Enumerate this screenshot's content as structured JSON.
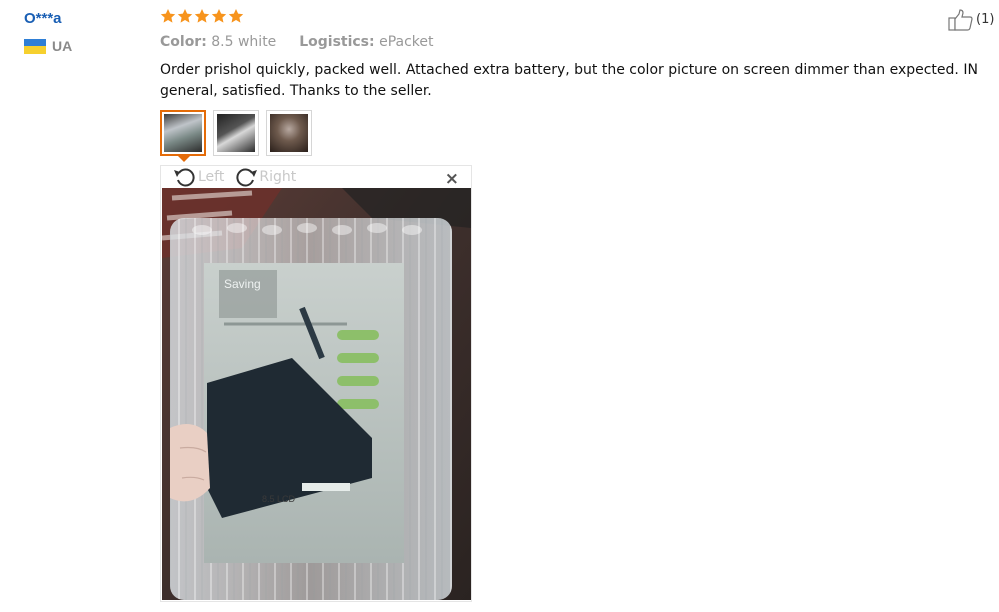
{
  "reviewer": {
    "name": "O***a",
    "country": "UA"
  },
  "rating": {
    "stars": 5,
    "max": 5,
    "color": "#f7941d"
  },
  "helpful": {
    "count": "(1)"
  },
  "meta": {
    "color_label": "Color:",
    "color_value": "8.5 white",
    "logistics_label": "Logistics:",
    "logistics_value": "ePacket"
  },
  "review_text": "Order prishol quickly, packed well. Attached extra battery, but the color picture on screen dimmer than expected. IN general, satisfied. Thanks to the seller.",
  "thumbnails": [
    {
      "name": "photo-1",
      "selected": true
    },
    {
      "name": "photo-2",
      "selected": false
    },
    {
      "name": "photo-3",
      "selected": false
    }
  ],
  "viewer": {
    "rotate_left_label": "Left",
    "rotate_right_label": "Right",
    "close_symbol": "×"
  },
  "photo_content": {
    "box_title": "Saving",
    "box_model": "8.5 LCD"
  },
  "colors": {
    "accent": "#e46b08",
    "link": "#1a5fb4",
    "muted": "#999999"
  }
}
